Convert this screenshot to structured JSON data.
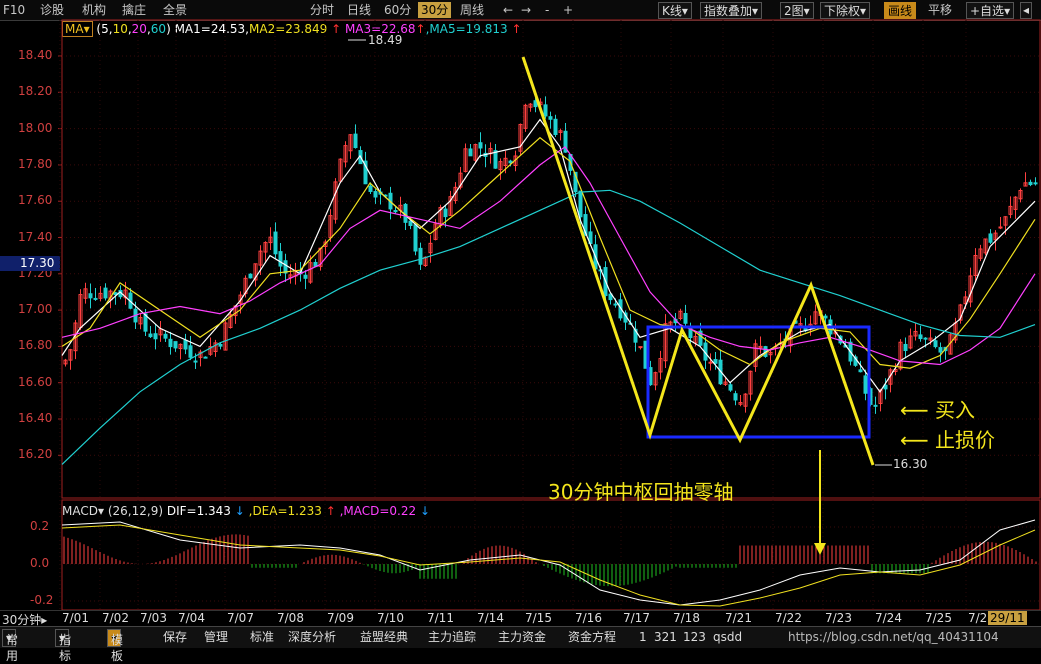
{
  "toolbar": {
    "left": [
      "F10",
      "诊股",
      "机构",
      "擒庄",
      "全景"
    ],
    "timeframes": [
      "分时",
      "日线",
      "60分",
      "30分",
      "周线"
    ],
    "active_timeframe": "30分",
    "nav_arrows": [
      "←",
      "→"
    ],
    "zoom": [
      "-",
      "+"
    ],
    "right_buttons": [
      "K线",
      "指数叠加",
      "2图",
      "下除权",
      "画线",
      "平移",
      "+自选"
    ],
    "active_right": "画线"
  },
  "ma_legend": {
    "label": "MA",
    "params_open": "(5,",
    "p10": "10",
    "comma1": ",",
    "p20": "20",
    "comma2": ",",
    "p60": "60",
    "params_close": ")",
    "ma1": "MA1=24.53,",
    "ma2": "MA2=23.849",
    "ma3": "MA3=22.68",
    "ma5": ",MA5=19.813"
  },
  "macd_legend": {
    "label": "MACD",
    "params": "(26,12,9)",
    "dif": "DIF=1.343",
    "dea": ",DEA=1.233",
    "macd": ",MACD=0.22"
  },
  "price_axis": [
    "18.40",
    "18.20",
    "18.00",
    "17.80",
    "17.60",
    "17.40",
    "17.20",
    "17.00",
    "16.80",
    "16.60",
    "16.40",
    "16.20"
  ],
  "current_price": "17.30",
  "high_label": "18.49",
  "low_label": "16.30",
  "macd_axis": [
    "0.2",
    "0.0",
    "-0.2"
  ],
  "period_label": "30分钟",
  "dates": [
    "7/01",
    "7/02",
    "7/03",
    "7/04",
    "7/07",
    "7/08",
    "7/09",
    "7/10",
    "7/11",
    "7/14",
    "7/15",
    "7/16",
    "7/17",
    "7/18",
    "7/21",
    "7/22",
    "7/23",
    "7/24",
    "7/25",
    "7/2"
  ],
  "last_date": "29/11",
  "annotations": {
    "buy": "买入",
    "stop": "止损价",
    "center": "30分钟中枢回抽零轴"
  },
  "bottom": {
    "tabs": [
      "常用",
      "指标",
      "模板"
    ],
    "active_tab": "模板",
    "items": [
      "保存",
      "管理",
      "标准",
      "深度分析",
      "益盟经典",
      "主力追踪",
      "主力资金",
      "资金方程"
    ],
    "pages": [
      "1",
      "321",
      "123",
      "qsdd"
    ]
  },
  "watermark": "https://blog.csdn.net/qq_40431104",
  "colors": {
    "up": "#ff4040",
    "down": "#20d0d0",
    "ma5": "#ffffff",
    "ma10": "#f0e020",
    "ma20": "#ff40ff",
    "ma60": "#20d0d0",
    "annotation": "#f4e61c",
    "box": "#1a2aff"
  }
}
